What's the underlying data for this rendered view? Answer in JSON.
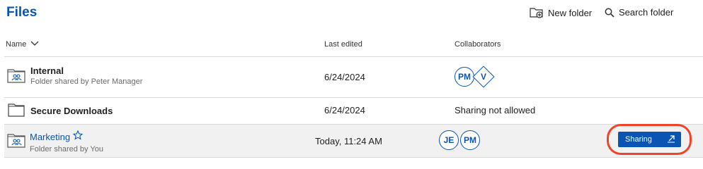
{
  "header": {
    "title": "Files",
    "new_folder_label": "New folder",
    "search_folder_label": "Search folder"
  },
  "columns": {
    "name": "Name",
    "last_edited": "Last edited",
    "collaborators": "Collaborators"
  },
  "rows": [
    {
      "name": "Internal",
      "subtitle": "Folder shared by Peter Manager",
      "date": "6/24/2024",
      "collaborators": [
        "PM",
        "V"
      ],
      "icon": "shared-folder-icon"
    },
    {
      "name": "Secure Downloads",
      "subtitle": "",
      "date": "6/24/2024",
      "collaborators_text": "Sharing not allowed",
      "icon": "folder-icon"
    },
    {
      "name": "Marketing",
      "subtitle": "Folder shared by You",
      "date": "Today, 11:24 AM",
      "collaborators": [
        "JE",
        "PM"
      ],
      "icon": "shared-folder-icon",
      "action_label": "Sharing"
    }
  ],
  "colors": {
    "accent": "#0a55b4",
    "highlight": "#f0442a",
    "selected_row": "#f1f1f1"
  }
}
